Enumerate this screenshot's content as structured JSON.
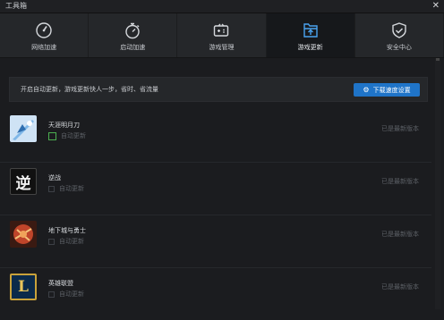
{
  "window": {
    "title": "工具箱",
    "close_glyph": "✕"
  },
  "tabs": [
    {
      "label": "网络加速",
      "icon": "speedometer-icon",
      "active": false
    },
    {
      "label": "启动加速",
      "icon": "stopwatch-icon",
      "active": false
    },
    {
      "label": "游戏管理",
      "icon": "gamepad-icon",
      "active": false
    },
    {
      "label": "游戏更新",
      "icon": "update-upload-icon",
      "active": true
    },
    {
      "label": "安全中心",
      "icon": "shield-check-icon",
      "active": false
    }
  ],
  "banner": {
    "text": "开启自动更新，游戏更新快人一步，省时、省流量",
    "button_label": "下载速度设置",
    "button_icon": "gear-icon",
    "button_color": "#1f74c8"
  },
  "games": [
    {
      "name": "天涯明月刀",
      "auto_label": "自动更新",
      "auto_checked": true,
      "status": "已是最新版本",
      "icon": "tianya-game-icon"
    },
    {
      "name": "逆战",
      "auto_label": "自动更新",
      "auto_checked": false,
      "status": "已是最新版本",
      "icon": "nizhan-game-icon",
      "icon_glyph": "逆"
    },
    {
      "name": "地下城与勇士",
      "auto_label": "自动更新",
      "auto_checked": false,
      "status": "已是最新版本",
      "icon": "dnf-game-icon"
    },
    {
      "name": "英雄联盟",
      "auto_label": "自动更新",
      "auto_checked": false,
      "status": "已是最新版本",
      "icon": "lol-game-icon",
      "icon_glyph": "L"
    }
  ],
  "colors": {
    "accent": "#1f74c8",
    "check_on": "#4caf50",
    "background": "#1b1c1f",
    "tab_bg": "#25272a",
    "tab_active_bg": "#16181b"
  }
}
